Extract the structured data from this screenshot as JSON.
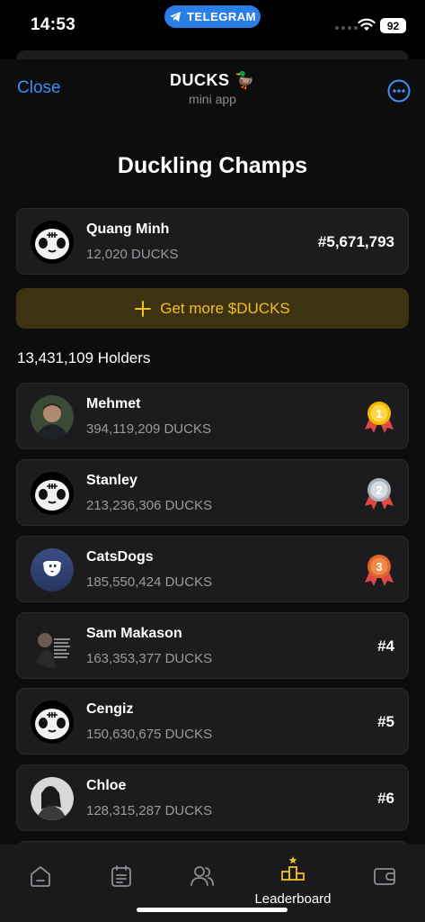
{
  "status_bar": {
    "time": "14:53",
    "telegram_label": "TELEGRAM",
    "battery": "92"
  },
  "header": {
    "close_label": "Close",
    "title": "DUCKS 🦆",
    "subtitle": "mini app"
  },
  "page": {
    "title": "Duckling Champs"
  },
  "current_user": {
    "name": "Quang Minh",
    "amount": "12,020 DUCKS",
    "rank": "#5,671,793"
  },
  "get_more": {
    "label": "Get more $DUCKS"
  },
  "holders_label": "13,431,109 Holders",
  "leaderboard": [
    {
      "name": "Mehmet",
      "amount": "394,119,209 DUCKS",
      "rank": "1",
      "medal": "gold"
    },
    {
      "name": "Stanley",
      "amount": "213,236,306 DUCKS",
      "rank": "2",
      "medal": "silver"
    },
    {
      "name": "CatsDogs",
      "amount": "185,550,424 DUCKS",
      "rank": "3",
      "medal": "bronze"
    },
    {
      "name": "Sam Makason",
      "amount": "163,353,377 DUCKS",
      "rank": "#4"
    },
    {
      "name": "Cengiz",
      "amount": "150,630,675 DUCKS",
      "rank": "#5"
    },
    {
      "name": "Chloe",
      "amount": "128,315,287 DUCKS",
      "rank": "#6"
    }
  ],
  "nav": {
    "active_label": "Leaderboard"
  },
  "colors": {
    "accent_blue": "#3f8ef5",
    "gold": "#f0c020",
    "background": "#0d0d0d",
    "card": "#1c1c1e"
  }
}
